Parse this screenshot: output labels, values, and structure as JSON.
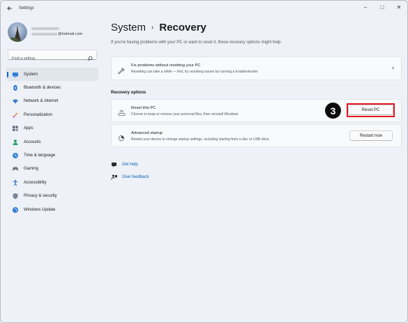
{
  "window": {
    "title": "Settings",
    "controls": {
      "minimize": "–",
      "maximize": "□",
      "close": "✕"
    }
  },
  "user": {
    "email_suffix": "@hotmail.com"
  },
  "search": {
    "placeholder": "Find a setting"
  },
  "sidebar": {
    "items": [
      {
        "label": "System",
        "icon": "system-icon",
        "active": true
      },
      {
        "label": "Bluetooth & devices",
        "icon": "bluetooth-icon"
      },
      {
        "label": "Network & internet",
        "icon": "wifi-icon"
      },
      {
        "label": "Personalization",
        "icon": "brush-icon"
      },
      {
        "label": "Apps",
        "icon": "apps-icon"
      },
      {
        "label": "Accounts",
        "icon": "accounts-icon"
      },
      {
        "label": "Time & language",
        "icon": "globe-clock-icon"
      },
      {
        "label": "Gaming",
        "icon": "gamepad-icon"
      },
      {
        "label": "Accessibility",
        "icon": "accessibility-icon"
      },
      {
        "label": "Privacy & security",
        "icon": "shield-icon"
      },
      {
        "label": "Windows Update",
        "icon": "update-icon"
      }
    ]
  },
  "main": {
    "breadcrumb": {
      "parent": "System",
      "separator": "›",
      "current": "Recovery"
    },
    "intro": "If you're having problems with your PC or want to reset it, these recovery options might help.",
    "fix_card": {
      "title": "Fix problems without resetting your PC",
      "desc": "Resetting can take a while — first, try resolving issues by running a troubleshooter",
      "chevron": "›"
    },
    "section_label": "Recovery options",
    "reset_card": {
      "title": "Reset this PC",
      "desc": "Choose to keep or remove your personal files, then reinstall Windows",
      "button": "Reset PC"
    },
    "advanced_card": {
      "title": "Advanced startup",
      "desc": "Restart your device to change startup settings, including starting from a disc or USB drive",
      "button": "Restart now"
    },
    "step_badge": "3",
    "links": {
      "help": "Get help",
      "feedback": "Give feedback"
    }
  },
  "colors": {
    "accent": "#0a63c9",
    "highlight": "#e0141e",
    "link": "#0a5fb4"
  }
}
